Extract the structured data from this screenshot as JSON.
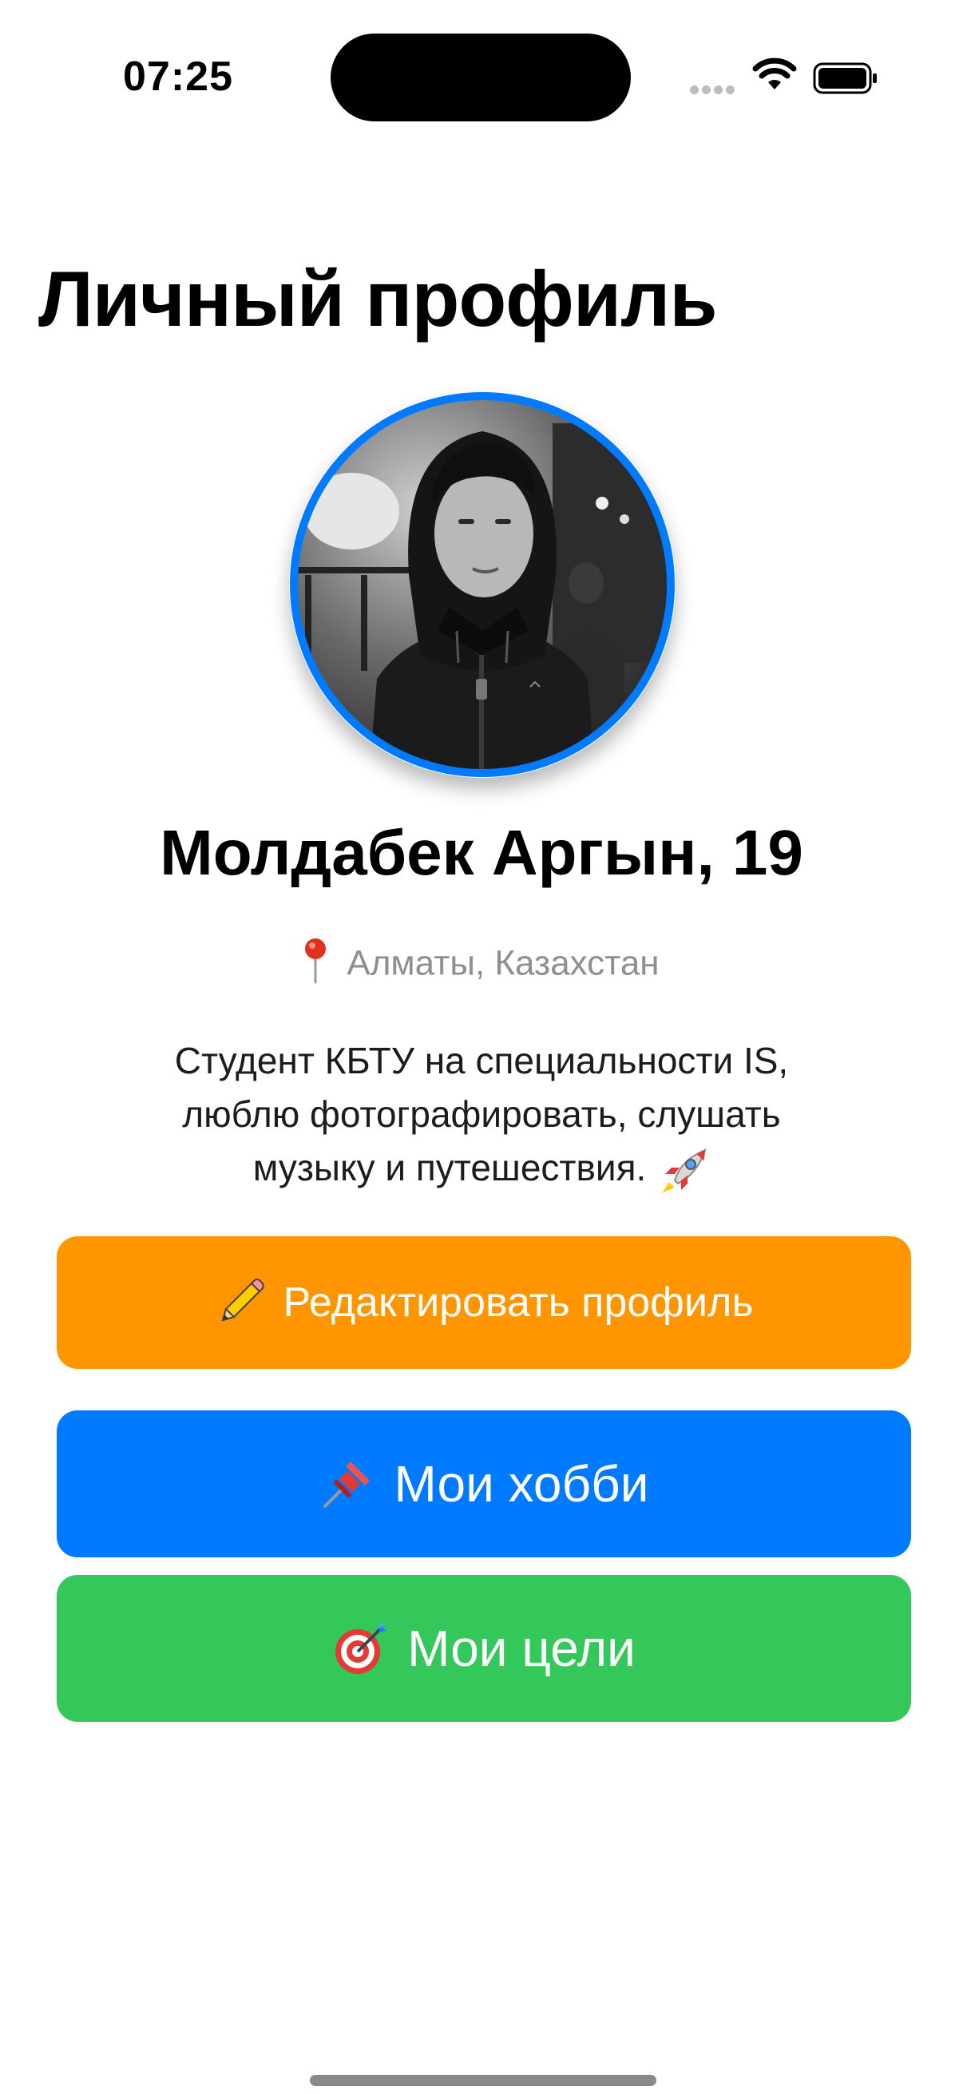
{
  "status_bar": {
    "time": "07:25",
    "icons": [
      "cellular-dots-icon",
      "wifi-icon",
      "battery-icon"
    ]
  },
  "page": {
    "title": "Личный профиль"
  },
  "profile": {
    "avatar_icon": "avatar-photo",
    "name": "Молдабек Аргын, 19",
    "location_icon": "pin-icon",
    "location": "Алматы, Казахстан",
    "bio": "Студент КБТУ на специальности IS, люблю фотографировать, слушать музыку и путешествия.",
    "bio_icon": "rocket-icon"
  },
  "actions": {
    "edit": {
      "icon": "pencil-icon",
      "label": "Редактировать профиль"
    },
    "hobbies": {
      "icon": "pushpin-icon",
      "label": "Мои хобби"
    },
    "goals": {
      "icon": "dart-icon",
      "label": "Мои цели"
    }
  },
  "colors": {
    "accent_blue": "#007aff",
    "edit_orange": "#ff9500",
    "goals_green": "#34c759",
    "secondary_text": "#8e8e93"
  }
}
